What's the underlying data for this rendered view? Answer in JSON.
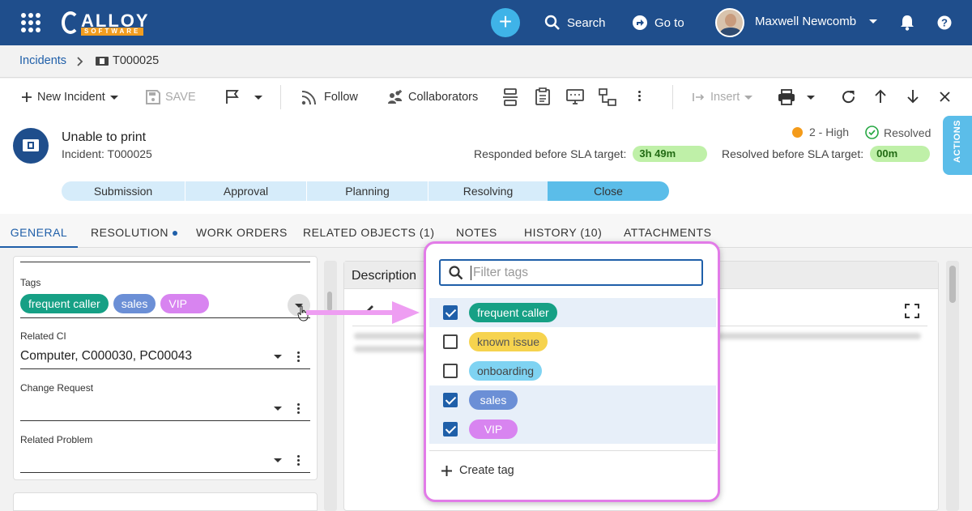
{
  "topbar": {
    "logo_main": "ALLOY",
    "logo_sub": "SOFTWARE",
    "search_label": "Search",
    "goto_label": "Go to",
    "user_name": "Maxwell Newcomb"
  },
  "breadcrumb": {
    "parent": "Incidents",
    "current": "T000025"
  },
  "toolbar": {
    "new_incident": "New Incident",
    "save": "SAVE",
    "follow": "Follow",
    "collaborators": "Collaborators",
    "insert": "Insert"
  },
  "incident": {
    "title": "Unable to print",
    "subtitle": "Incident: T000025",
    "priority": "2 - High",
    "status": "Resolved",
    "responded_label": "Responded before SLA target:",
    "responded_value": "3h 49m",
    "resolved_label": "Resolved before SLA target:",
    "resolved_value": "00m",
    "actions_tab": "ACTIONS",
    "stages": [
      "Submission",
      "Approval",
      "Planning",
      "Resolving",
      "Close"
    ]
  },
  "tabs": [
    "GENERAL",
    "RESOLUTION",
    "WORK ORDERS",
    "RELATED OBJECTS (1)",
    "NOTES",
    "HISTORY (10)",
    "ATTACHMENTS"
  ],
  "form": {
    "tags_label": "Tags",
    "tags": [
      "frequent caller",
      "sales",
      "VIP"
    ],
    "related_ci_label": "Related CI",
    "related_ci_value": "Computer, C000030, PC00043",
    "change_request_label": "Change Request",
    "related_problem_label": "Related Problem"
  },
  "description": {
    "title": "Description"
  },
  "tag_popup": {
    "filter_placeholder": "Filter tags",
    "options": [
      {
        "label": "frequent caller",
        "checked": true
      },
      {
        "label": "known issue",
        "checked": false
      },
      {
        "label": "onboarding",
        "checked": false
      },
      {
        "label": "sales",
        "checked": true
      },
      {
        "label": "VIP",
        "checked": true
      }
    ],
    "create_label": "Create tag"
  },
  "colors": {
    "topbar": "#1f4e8c",
    "accent": "#1f5fa9",
    "tag_frequent_caller": "#16a085",
    "tag_known_issue": "#f6d34e",
    "tag_onboarding": "#7fd3f2",
    "tag_sales": "#6b8fd6",
    "tag_vip": "#d884f0",
    "highlight": "#e27be8"
  }
}
